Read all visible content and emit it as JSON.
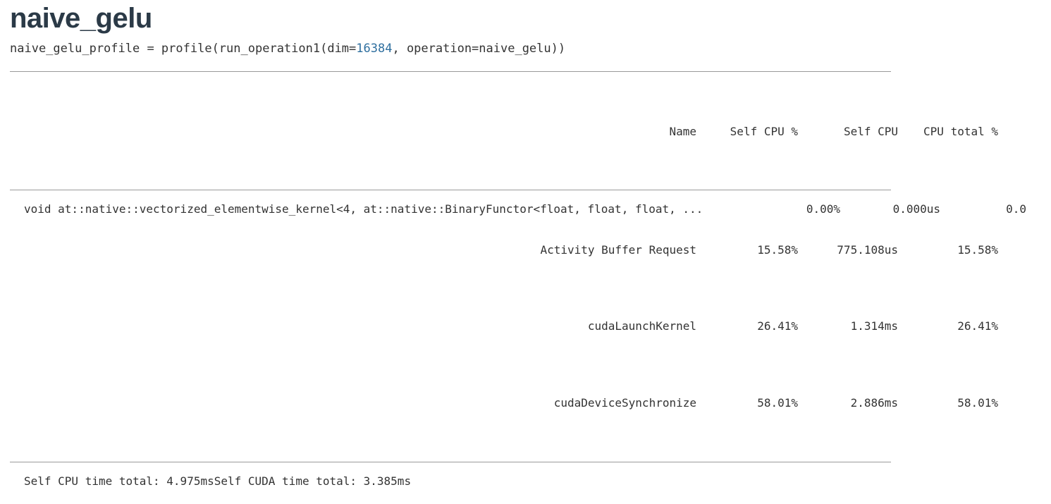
{
  "title": "naive_gelu",
  "code": {
    "prefix": "naive_gelu_profile = profile(run_operation1(dim=",
    "dim_value": "16384",
    "suffix": ", operation=naive_gelu))"
  },
  "table": {
    "headers": {
      "name": "Name",
      "self_cpu_pct": "Self CPU %",
      "self_cpu": "Self CPU",
      "cpu_total_pct": "CPU total %"
    },
    "rows": [
      {
        "name": "void at::native::vectorized_elementwise_kernel<4, at::native::BinaryFunctor<float, float, float, ...",
        "self_cpu_pct": "0.00%",
        "self_cpu": "0.000us",
        "cpu_total_pct": "0.0"
      },
      {
        "name": "Activity Buffer Request",
        "self_cpu_pct": "15.58%",
        "self_cpu": "775.108us",
        "cpu_total_pct": "15.58%"
      },
      {
        "name": "cudaLaunchKernel",
        "self_cpu_pct": "26.41%",
        "self_cpu": "1.314ms",
        "cpu_total_pct": "26.41%"
      },
      {
        "name": "cudaDeviceSynchronize",
        "self_cpu_pct": "58.01%",
        "self_cpu": "2.886ms",
        "cpu_total_pct": "58.01%"
      }
    ]
  },
  "footer": {
    "text": "Self CPU time total: 4.975msSelf CUDA time total: 3.385ms"
  }
}
